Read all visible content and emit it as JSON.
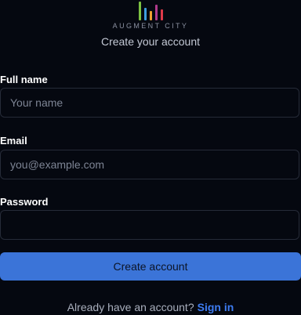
{
  "brand": {
    "wordmark": "AUGMENT CITY",
    "bar_colors": [
      "#7cc242",
      "#3e9de0",
      "#f0a030",
      "#b03a8c",
      "#e03a4a"
    ]
  },
  "header": {
    "subtitle": "Create your account"
  },
  "form": {
    "full_name": {
      "label": "Full name",
      "placeholder": "Your name",
      "value": ""
    },
    "email": {
      "label": "Email",
      "placeholder": "you@example.com",
      "value": ""
    },
    "password": {
      "label": "Password",
      "placeholder": "",
      "value": ""
    },
    "submit_label": "Create account"
  },
  "footer": {
    "prompt": "Already have an account?",
    "link_label": "Sign in"
  },
  "colors": {
    "background": "#050810",
    "primary": "#3b74d8",
    "link": "#3d7bf0"
  }
}
